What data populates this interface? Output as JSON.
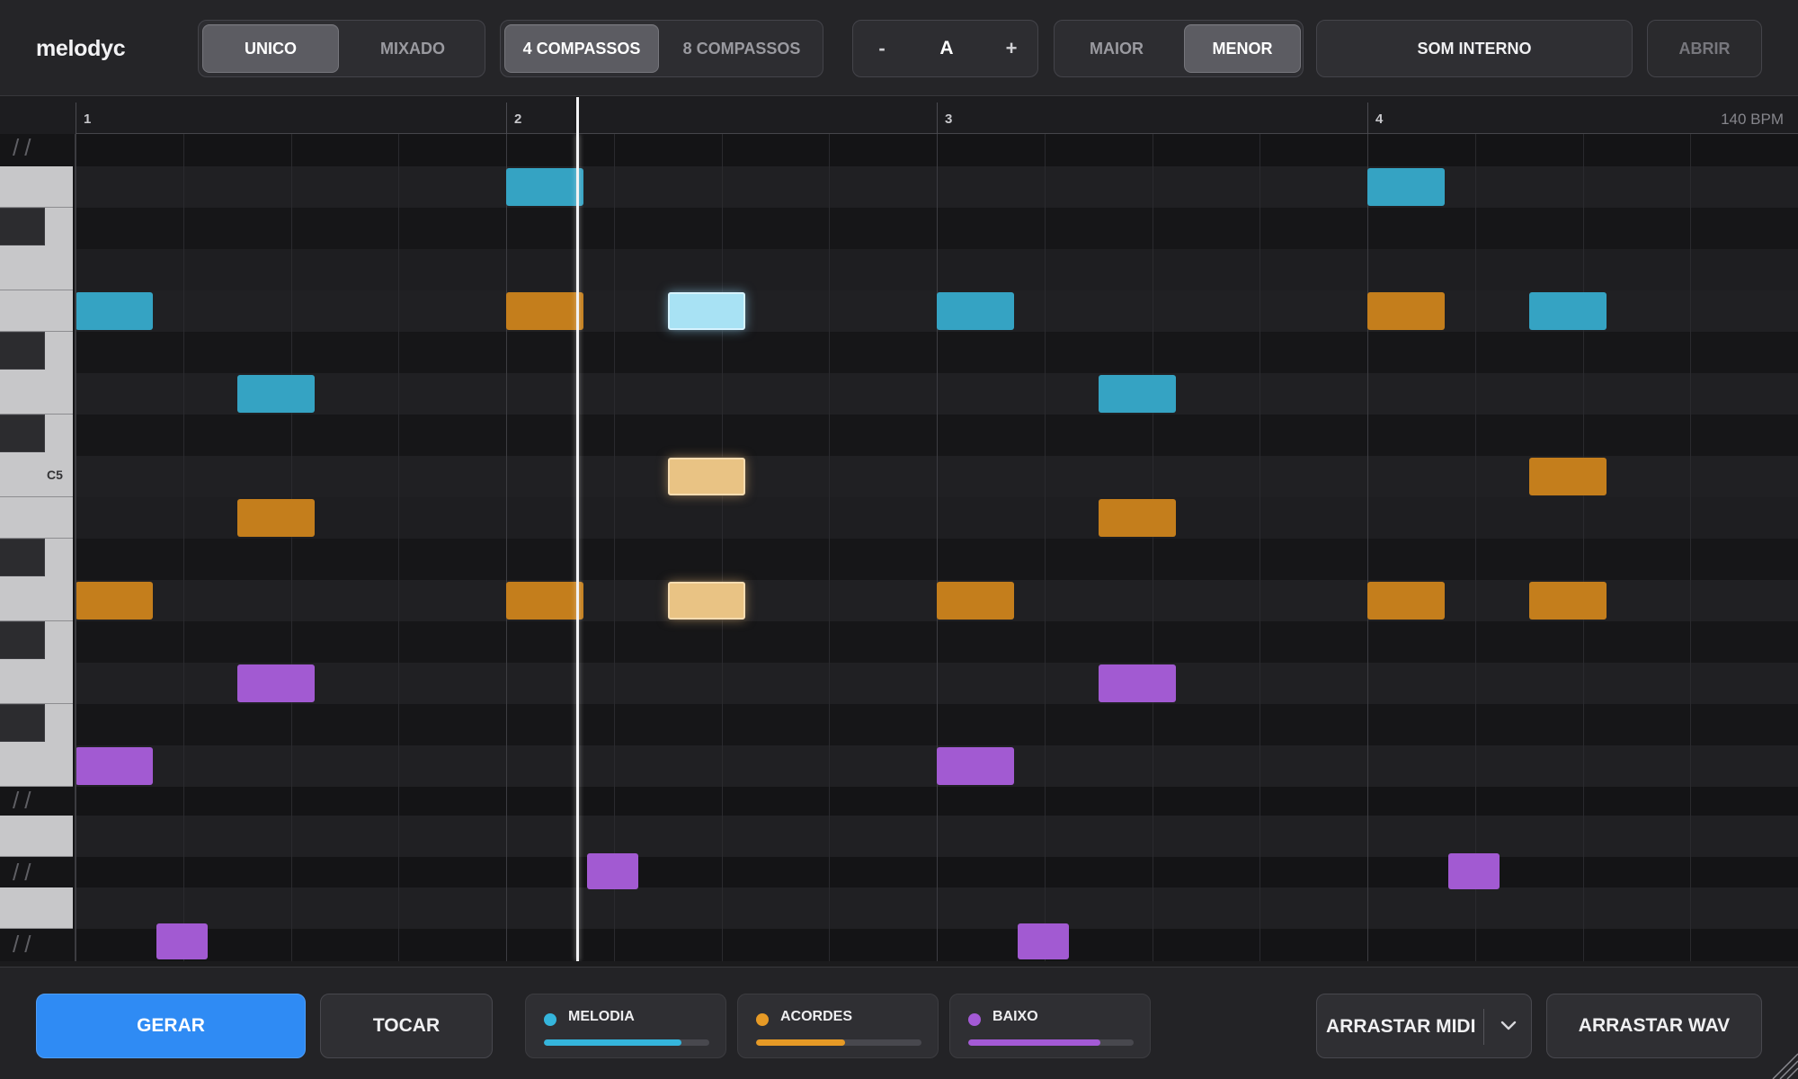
{
  "app": {
    "title": "melodyc"
  },
  "toolbar": {
    "mode": {
      "options": [
        "UNICO",
        "MIXADO"
      ],
      "selected": "UNICO"
    },
    "length": {
      "options": [
        "4 COMPASSOS",
        "8 COMPASSOS"
      ],
      "selected": "4 COMPASSOS"
    },
    "key": {
      "decrement": "-",
      "value": "A",
      "increment": "+"
    },
    "scale": {
      "options": [
        "MAIOR",
        "MENOR"
      ],
      "selected": "MENOR"
    },
    "sound_label": "SOM INTERNO",
    "open_label": "ABRIR"
  },
  "ruler": {
    "bars": [
      "1",
      "2",
      "3",
      "4"
    ],
    "tempo": "140 BPM"
  },
  "keyboard": {
    "c5_label": "C5"
  },
  "grid": {
    "bars": 4,
    "steps_per_bar": 16,
    "playhead_step": 18.6,
    "notes": [
      {
        "track": "melodia",
        "row": 0,
        "start": 16,
        "len": 3
      },
      {
        "track": "melodia",
        "row": 0,
        "start": 48,
        "len": 3
      },
      {
        "track": "melodia",
        "row": 3,
        "start": 0,
        "len": 3
      },
      {
        "track": "melodia",
        "row": 3,
        "start": 22,
        "len": 3,
        "highlight": true
      },
      {
        "track": "melodia",
        "row": 3,
        "start": 32,
        "len": 3
      },
      {
        "track": "melodia",
        "row": 3,
        "start": 54,
        "len": 3
      },
      {
        "track": "melodia",
        "row": 5,
        "start": 6,
        "len": 3
      },
      {
        "track": "melodia",
        "row": 5,
        "start": 38,
        "len": 3
      },
      {
        "track": "acordes",
        "row": 3,
        "start": 16,
        "len": 3
      },
      {
        "track": "acordes",
        "row": 3,
        "start": 48,
        "len": 3
      },
      {
        "track": "acordes",
        "row": 7,
        "start": 22,
        "len": 3,
        "highlight": true
      },
      {
        "track": "acordes",
        "row": 7,
        "start": 54,
        "len": 3
      },
      {
        "track": "acordes",
        "row": 8,
        "start": 6,
        "len": 3
      },
      {
        "track": "acordes",
        "row": 8,
        "start": 38,
        "len": 3
      },
      {
        "track": "acordes",
        "row": 10,
        "start": 0,
        "len": 3
      },
      {
        "track": "acordes",
        "row": 10,
        "start": 16,
        "len": 3
      },
      {
        "track": "acordes",
        "row": 10,
        "start": 22,
        "len": 3,
        "highlight": true
      },
      {
        "track": "acordes",
        "row": 10,
        "start": 32,
        "len": 3
      },
      {
        "track": "acordes",
        "row": 10,
        "start": 48,
        "len": 3
      },
      {
        "track": "acordes",
        "row": 10,
        "start": 54,
        "len": 3
      },
      {
        "track": "baixo",
        "row": 12,
        "start": 6,
        "len": 3
      },
      {
        "track": "baixo",
        "row": 12,
        "start": 38,
        "len": 3
      },
      {
        "track": "baixo",
        "row": 14,
        "start": 0,
        "len": 3
      },
      {
        "track": "baixo",
        "row": 14,
        "start": 32,
        "len": 3
      },
      {
        "track": "baixo",
        "row": 16.5,
        "start": 19,
        "len": 2
      },
      {
        "track": "baixo",
        "row": 16.5,
        "start": 51,
        "len": 2
      },
      {
        "track": "baixo",
        "row": 18.2,
        "start": 3,
        "len": 2
      },
      {
        "track": "baixo",
        "row": 18.2,
        "start": 35,
        "len": 2
      }
    ]
  },
  "footer": {
    "generate_label": "GERAR",
    "play_label": "TOCAR",
    "tracks": [
      {
        "name": "MELODIA",
        "color": "#35b5dc",
        "volume": 0.83
      },
      {
        "name": "ACORDES",
        "color": "#e69a26",
        "volume": 0.54
      },
      {
        "name": "BAIXO",
        "color": "#a45ad6",
        "volume": 0.8
      }
    ],
    "drag_midi_label": "ARRASTAR MIDI",
    "drag_wav_label": "ARRASTAR WAV"
  },
  "colors": {
    "accent": "#2f8bf4",
    "melodia": "#35a3c3",
    "acordes": "#c47e1c",
    "baixo": "#a25ad2"
  }
}
